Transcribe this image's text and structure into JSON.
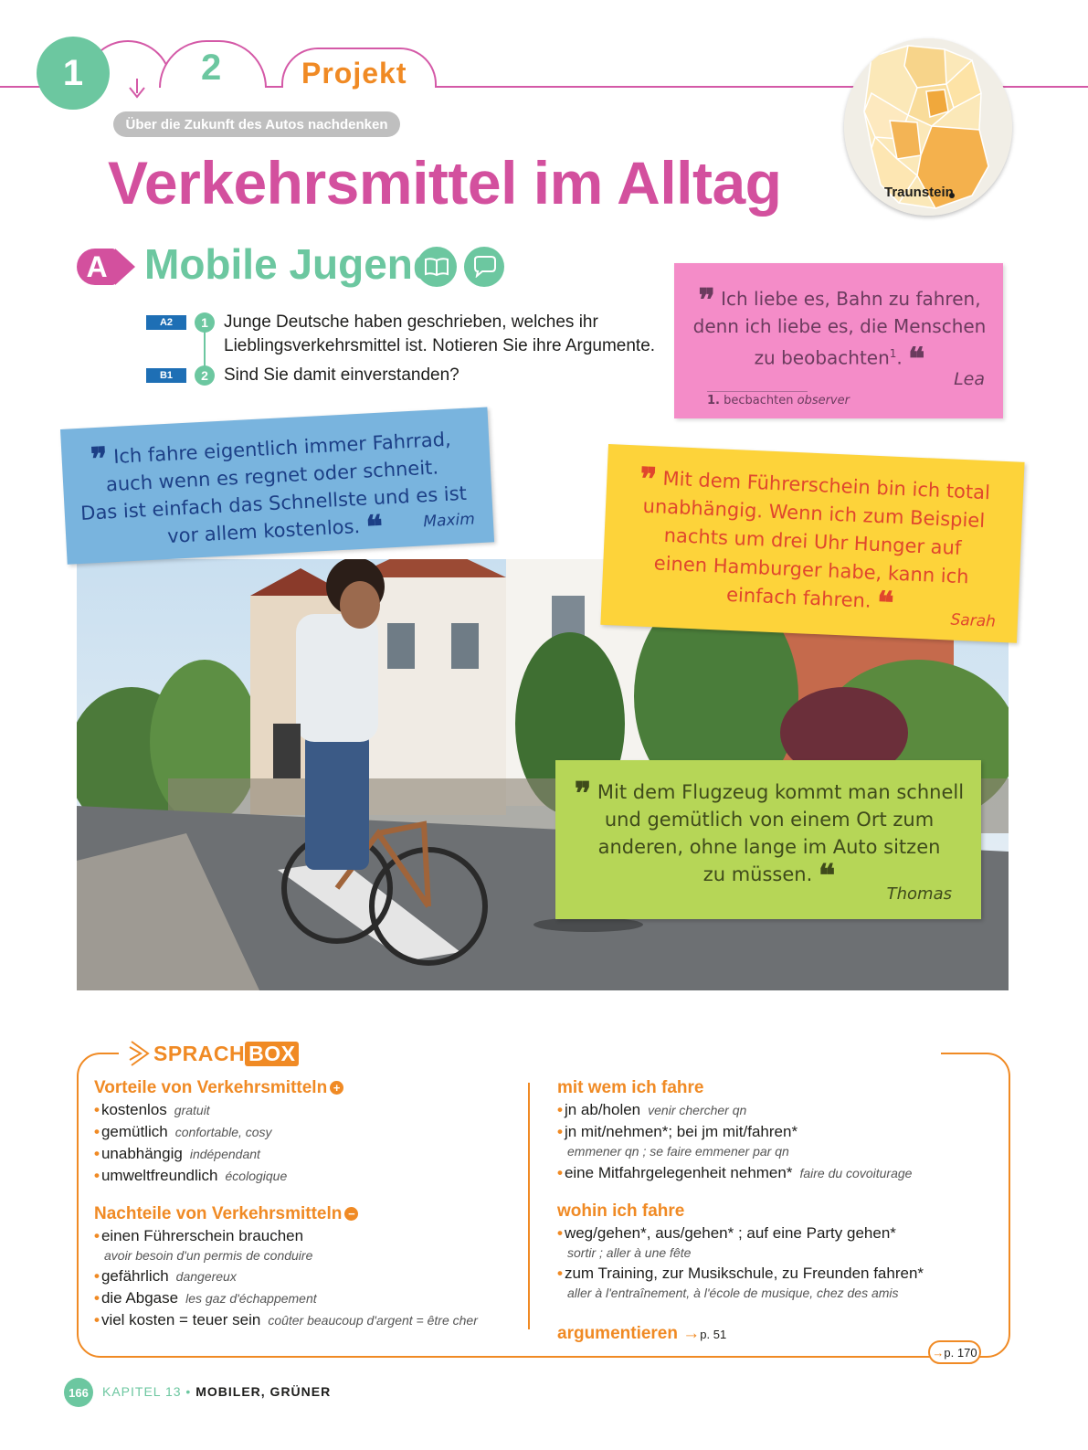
{
  "nav": {
    "tab1": "1",
    "tab2": "2",
    "tab3": "Projekt",
    "subtitle": "Über die Zukunft des Autos nachdenken"
  },
  "title": "Verkehrsmittel im Alltag",
  "map": {
    "label": "Traunstein"
  },
  "section": {
    "badge": "A",
    "title": "Mobile Jugend",
    "icons": [
      "book-icon",
      "speech-bubble-icon"
    ]
  },
  "exercises": [
    {
      "level": "A2",
      "number": "1",
      "line1": "Junge Deutsche haben geschrieben, welches ihr",
      "line2": "Lieblingsverkehrsmittel ist. Notieren Sie ihre Argumente."
    },
    {
      "level": "B1",
      "number": "2",
      "line1": "Sind Sie damit einverstanden?"
    }
  ],
  "quotes": {
    "lea": {
      "lines": [
        "Ich liebe es, Bahn zu fahren,",
        "denn ich liebe es, die Menschen",
        "zu beobachten"
      ],
      "sup": "1",
      "author": "Lea",
      "footnote_num": "1.",
      "footnote_word": "becbachten",
      "footnote_tr": "observer"
    },
    "maxim": {
      "lines": [
        "Ich fahre eigentlich immer Fahrrad,",
        "auch wenn es regnet oder schneit.",
        "Das ist einfach das Schnellste und es ist",
        "vor allem kostenlos."
      ],
      "author": "Maxim"
    },
    "sarah": {
      "lines": [
        "Mit dem Führerschein bin ich total",
        "unabhängig. Wenn ich zum Beispiel",
        "nachts um drei Uhr Hunger auf",
        "einen Hamburger habe, kann ich",
        "einfach fahren."
      ],
      "author": "Sarah"
    },
    "thomas": {
      "lines": [
        "Mit dem Flugzeug kommt man schnell",
        "und gemütlich von einem Ort zum",
        "anderen, ohne lange im Auto sitzen",
        "zu müssen."
      ],
      "author": "Thomas"
    }
  },
  "sprachbox": {
    "title_a": "SPRACH",
    "title_b": "BOX",
    "left": {
      "head1": "Vorteile von Verkehrsmitteln",
      "pros": [
        {
          "de": "kostenlos",
          "fr": "gratuit"
        },
        {
          "de": "gemütlich",
          "fr": "confortable, cosy"
        },
        {
          "de": "unabhängig",
          "fr": "indépendant"
        },
        {
          "de": "umweltfreundlich",
          "fr": "écologique"
        }
      ],
      "head2": "Nachteile von Verkehrsmitteln",
      "cons": [
        {
          "de": "einen Führerschein brauchen",
          "fr": "avoir besoin d'un permis de conduire"
        },
        {
          "de": "gefährlich",
          "fr": "dangereux"
        },
        {
          "de": "die Abgase",
          "fr": "les gaz d'échappement"
        },
        {
          "de": "viel kosten = teuer sein",
          "fr": "coûter beaucoup d'argent = être cher"
        }
      ]
    },
    "right": {
      "head1": "mit wem ich fahre",
      "with": [
        {
          "de": "jn ab/holen",
          "fr": "venir chercher qn"
        },
        {
          "de": "jn mit/nehmen*; bei jm mit/fahren*",
          "fr": "emmener qn ; se faire emmener par qn"
        },
        {
          "de": "eine Mitfahrgelegenheit nehmen*",
          "fr": "faire du covoiturage"
        }
      ],
      "head2": "wohin ich fahre",
      "where": [
        {
          "de": "weg/gehen*, aus/gehen* ; auf eine Party gehen*",
          "fr": "sortir ; aller à une fête"
        },
        {
          "de": "zum Training, zur Musikschule, zu Freunden fahren*",
          "fr": "aller à l'entraînement, à l'école de musique, chez des amis"
        }
      ],
      "argue": "argumentieren",
      "argue_ref": "p. 51",
      "page_ref": "p. 170"
    }
  },
  "footer": {
    "page": "166",
    "chapter": "KAPITEL 13",
    "topic": "MOBILER, GRÜNER"
  },
  "colors": {
    "pink": "#d3509e",
    "green": "#6cc7a0",
    "orange": "#f08a24",
    "blue_badge": "#1e6fb5"
  }
}
